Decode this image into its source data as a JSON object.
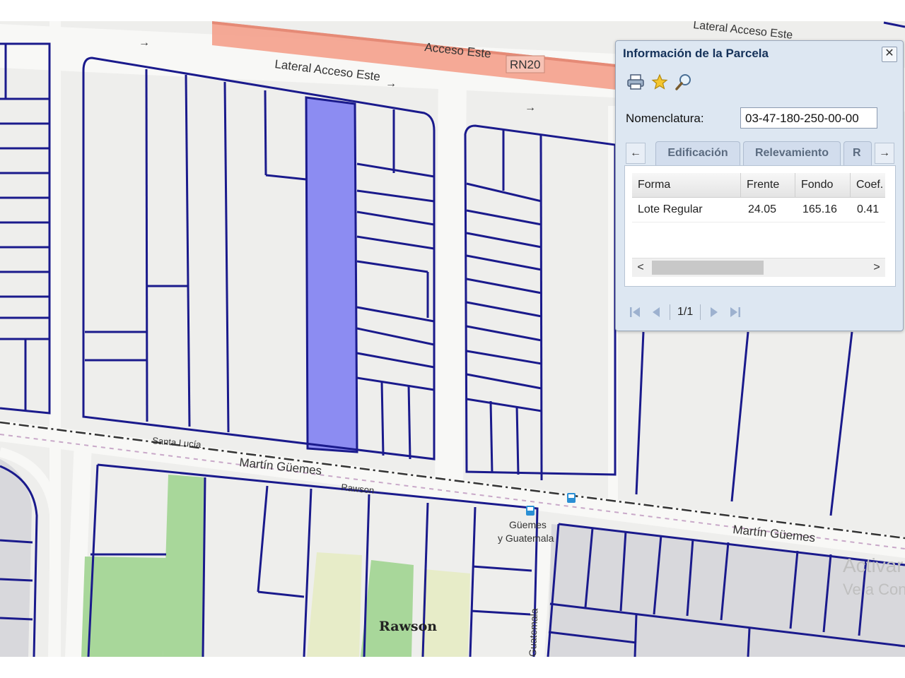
{
  "map": {
    "street_labels": {
      "acceso_este": "Acceso Este",
      "route_badge": "RN20",
      "lateral_top_right": "Lateral Acceso Este",
      "lateral_main": "Lateral Acceso Este",
      "santa_lucia": "Santa Lucía",
      "martin_guemes_left": "Martín Güemes",
      "rawson_small": "Rawson",
      "martin_guemes_right": "Martín Güemes",
      "guatemala": "Guatemala",
      "district": "Rawson"
    },
    "bus_stop": {
      "line1": "Güemes",
      "line2": "y Guatemala"
    },
    "watermark": {
      "line1": "Activar",
      "line2": "Ve a Con"
    },
    "colors": {
      "background": "#eeeeec",
      "parcel_stroke": "#1a1a8c",
      "selected_parcel": "#8c8cf2",
      "highway": "#f4a08c",
      "green_area": "#a8d79a",
      "railway": "#444444"
    }
  },
  "panel": {
    "title": "Información de la Parcela",
    "close_label": "✕",
    "toolbar": [
      "print-icon",
      "star-icon",
      "magnifier-icon"
    ],
    "nomenclatura": {
      "label": "Nomenclatura:",
      "value": "03-47-180-250-00-00"
    },
    "tabs": [
      "Edificación",
      "Relevamiento",
      "R"
    ],
    "tab_prev": "←",
    "tab_next": "→",
    "grid": {
      "columns": [
        "Forma",
        "Frente",
        "Fondo",
        "Coef."
      ],
      "rows": [
        [
          "Lote Regular",
          "24.05",
          "165.16",
          "0.41"
        ]
      ]
    },
    "scroll_left": "<",
    "scroll_right": ">",
    "pager": {
      "page": "1/1"
    }
  }
}
